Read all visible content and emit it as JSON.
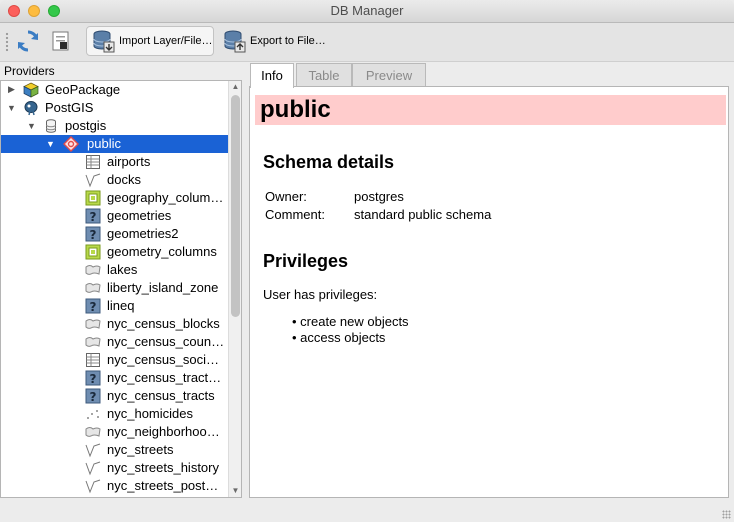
{
  "window": {
    "title": "DB Manager"
  },
  "toolbar": {
    "refresh_icon": "refresh-icon",
    "info_icon": "sql-window-icon",
    "import_label": "Import Layer/File…",
    "export_label": "Export to File…"
  },
  "providers": {
    "label": "Providers",
    "items": [
      {
        "text": "GeoPackage",
        "icon": "geopackage-icon"
      },
      {
        "text": "PostGIS",
        "icon": "postgis-icon"
      },
      {
        "text": "postgis",
        "icon": "database-icon"
      },
      {
        "text": "public",
        "icon": "schema-icon"
      },
      {
        "text": "airports",
        "icon": "table-icon"
      },
      {
        "text": "docks",
        "icon": "line-layer-icon"
      },
      {
        "text": "geography_colum…",
        "icon": "view-icon"
      },
      {
        "text": "geometries",
        "icon": "unknown-geometry-icon"
      },
      {
        "text": "geometries2",
        "icon": "unknown-geometry-icon"
      },
      {
        "text": "geometry_columns",
        "icon": "view-icon"
      },
      {
        "text": "lakes",
        "icon": "polygon-layer-icon"
      },
      {
        "text": "liberty_island_zone",
        "icon": "polygon-layer-icon"
      },
      {
        "text": "lineq",
        "icon": "unknown-geometry-icon"
      },
      {
        "text": "nyc_census_blocks",
        "icon": "polygon-layer-icon"
      },
      {
        "text": "nyc_census_coun…",
        "icon": "polygon-layer-icon"
      },
      {
        "text": "nyc_census_soci…",
        "icon": "table-icon"
      },
      {
        "text": "nyc_census_tract…",
        "icon": "unknown-geometry-icon"
      },
      {
        "text": "nyc_census_tracts",
        "icon": "unknown-geometry-icon"
      },
      {
        "text": "nyc_homicides",
        "icon": "point-layer-icon"
      },
      {
        "text": "nyc_neighborhoo…",
        "icon": "polygon-layer-icon"
      },
      {
        "text": "nyc_streets",
        "icon": "line-layer-icon"
      },
      {
        "text": "nyc_streets_history",
        "icon": "line-layer-icon"
      },
      {
        "text": "nyc_streets_post…",
        "icon": "line-layer-icon"
      }
    ]
  },
  "tabs": [
    {
      "label": "Info",
      "active": true
    },
    {
      "label": "Table",
      "active": false
    },
    {
      "label": "Preview",
      "active": false
    }
  ],
  "info": {
    "heading": "public",
    "schema_title": "Schema details",
    "owner_label": "Owner:",
    "owner_value": "postgres",
    "comment_label": "Comment:",
    "comment_value": "standard public schema",
    "privileges_title": "Privileges",
    "privileges_intro": "User has privileges:",
    "privileges": [
      "• create new objects",
      "• access objects"
    ]
  },
  "colors": {
    "selection": "#1a62d5",
    "header_band": "#ffcccc"
  }
}
